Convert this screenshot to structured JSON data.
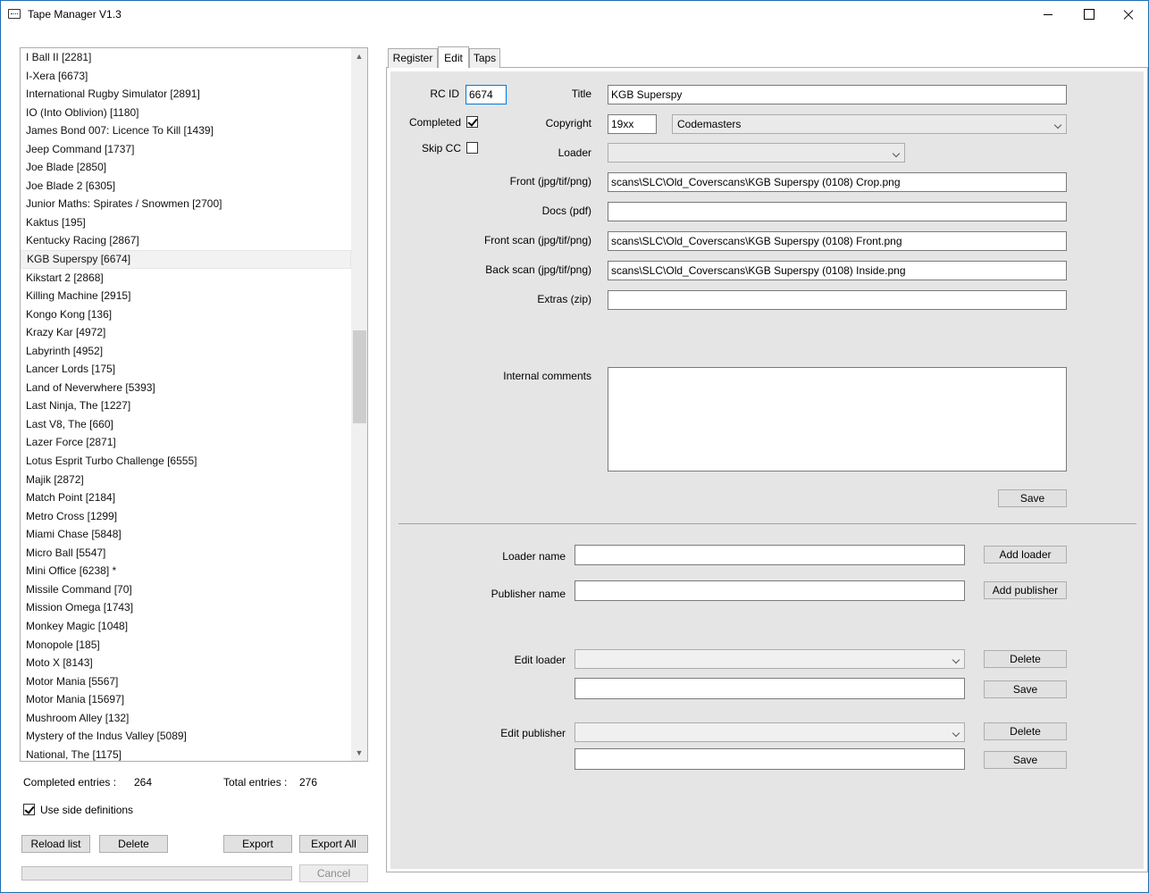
{
  "window": {
    "title": "Tape Manager V1.3"
  },
  "list": {
    "items": [
      "I Ball II [2281]",
      "I-Xera [6673]",
      "International Rugby Simulator [2891]",
      "IO (Into Oblivion) [1180]",
      "James Bond 007: Licence To Kill [1439]",
      "Jeep Command [1737]",
      "Joe Blade [2850]",
      "Joe Blade 2 [6305]",
      "Junior Maths: Spirates / Snowmen [2700]",
      "Kaktus [195]",
      "Kentucky Racing [2867]",
      "KGB Superspy [6674]",
      "Kikstart 2 [2868]",
      "Killing Machine [2915]",
      "Kongo Kong [136]",
      "Krazy Kar [4972]",
      "Labyrinth [4952]",
      "Lancer Lords [175]",
      "Land of Neverwhere [5393]",
      "Last Ninja, The [1227]",
      "Last V8, The [660]",
      "Lazer Force [2871]",
      "Lotus Esprit Turbo Challenge [6555]",
      "Majik [2872]",
      "Match Point [2184]",
      "Metro Cross [1299]",
      "Miami Chase [5848]",
      "Micro Ball [5547]",
      "Mini Office [6238] *",
      "Missile Command [70]",
      "Mission Omega [1743]",
      "Monkey Magic [1048]",
      "Monopole [185]",
      "Moto X [8143]",
      "Motor Mania [5567]",
      "Motor Mania [15697]",
      "Mushroom Alley [132]",
      "Mystery of the Indus Valley [5089]",
      "National, The [1175]"
    ],
    "selected": "KGB Superspy [6674]"
  },
  "stats": {
    "completed_label": "Completed entries :",
    "completed_value": "264",
    "total_label": "Total entries :",
    "total_value": "276"
  },
  "side_definitions": {
    "label": "Use side definitions",
    "checked": true
  },
  "buttons": {
    "reload": "Reload list",
    "delete": "Delete",
    "export": "Export",
    "export_all": "Export All",
    "cancel": "Cancel"
  },
  "progress": {
    "fraction": 0
  },
  "tabs": [
    "Register",
    "Edit",
    "Taps"
  ],
  "active_tab": "Edit",
  "edit": {
    "rcid_label": "RC ID",
    "rcid_value": "6674",
    "title_label": "Title",
    "title_value": "KGB Superspy",
    "completed_label": "Completed",
    "completed_checked": true,
    "copyright_label": "Copyright",
    "copyright_year": "19xx",
    "publisher_value": "Codemasters",
    "skipcc_label": "Skip CC",
    "skipcc_checked": false,
    "loader_label": "Loader",
    "loader_value": "",
    "front_label": "Front (jpg/tif/png)",
    "front_value": "scans\\SLC\\Old_Coverscans\\KGB Superspy (0108) Crop.png",
    "docs_label": "Docs (pdf)",
    "docs_value": "",
    "front_scan_label": "Front scan (jpg/tif/png)",
    "front_scan_value": "scans\\SLC\\Old_Coverscans\\KGB Superspy (0108) Front.png",
    "back_scan_label": "Back scan (jpg/tif/png)",
    "back_scan_value": "scans\\SLC\\Old_Coverscans\\KGB Superspy (0108) Inside.png",
    "extras_label": "Extras (zip)",
    "extras_value": "",
    "comments_label": "Internal comments",
    "comments_value": "",
    "save_label": "Save"
  },
  "manage": {
    "loader_name_label": "Loader name",
    "publisher_name_label": "Publisher name",
    "add_loader": "Add loader",
    "add_publisher": "Add publisher",
    "edit_loader_label": "Edit loader",
    "edit_publisher_label": "Edit publisher",
    "delete": "Delete",
    "save": "Save"
  }
}
